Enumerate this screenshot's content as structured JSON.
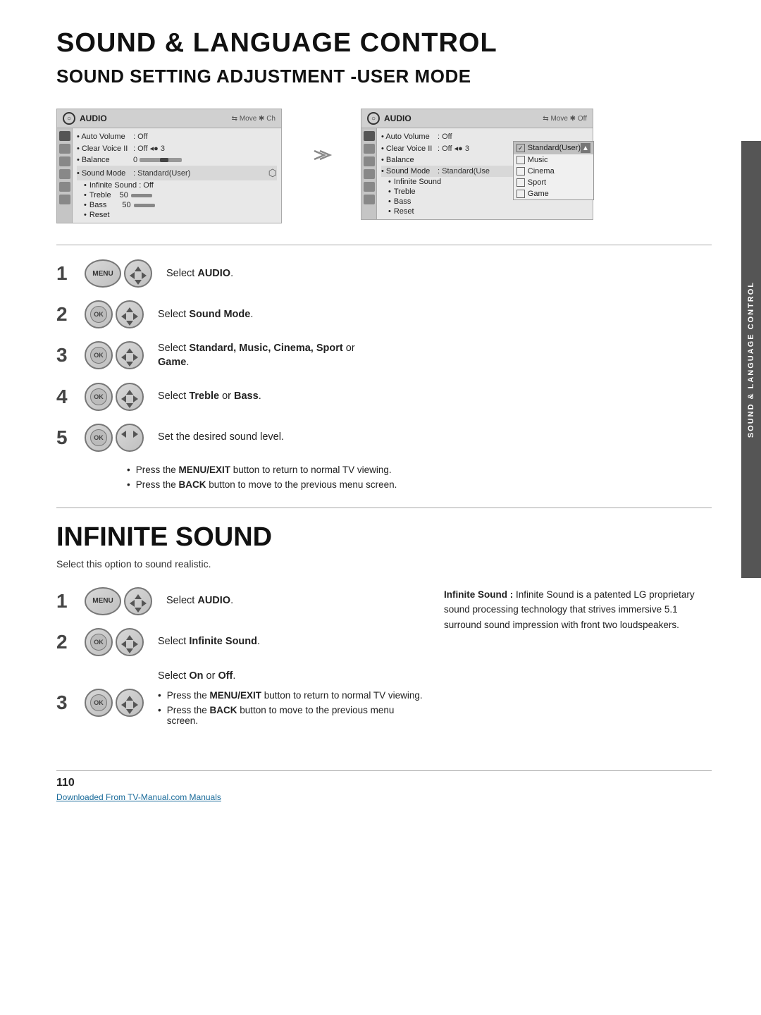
{
  "page": {
    "main_title": "SOUND & LANGUAGE CONTROL",
    "sub_title": "SOUND SETTING ADJUSTMENT -USER MODE",
    "side_label": "SOUND & LANGUAGE CONTROL",
    "page_number": "110",
    "footer_link": "Downloaded From TV-Manual.com Manuals"
  },
  "audio_panel_left": {
    "title": "AUDIO",
    "nav": "Move  Ok Ch",
    "rows": [
      {
        "label": "Auto Volume",
        "value": ": Off"
      },
      {
        "label": "Clear Voice II",
        "value": ": Off  3"
      },
      {
        "label": "Balance",
        "value": "0"
      },
      {
        "label": "Sound Mode",
        "value": ": Standard(User)"
      }
    ],
    "sub_rows": [
      {
        "label": "Infinite Sound",
        "value": ": Off"
      },
      {
        "label": "Treble",
        "value": "50"
      },
      {
        "label": "Bass",
        "value": "50"
      },
      {
        "label": "Reset",
        "value": ""
      }
    ]
  },
  "audio_panel_right": {
    "title": "AUDIO",
    "nav": "Move  Ok Off",
    "rows": [
      {
        "label": "Auto Volume",
        "value": ": Off"
      },
      {
        "label": "Clear Voice II",
        "value": ": Off  3"
      },
      {
        "label": "Balance",
        "value": ""
      },
      {
        "label": "Sound Mode",
        "value": ": Standard(Use"
      }
    ],
    "sub_rows": [
      {
        "label": "Infinite Sound",
        "value": ""
      },
      {
        "label": "Treble",
        "value": ""
      },
      {
        "label": "Bass",
        "value": ""
      },
      {
        "label": "Reset",
        "value": ""
      }
    ],
    "dropdown": {
      "items": [
        {
          "label": "Standard(User)",
          "checked": true
        },
        {
          "label": "Music",
          "checked": false
        },
        {
          "label": "Cinema",
          "checked": false
        },
        {
          "label": "Sport",
          "checked": false
        },
        {
          "label": "Game",
          "checked": false
        }
      ]
    }
  },
  "steps_section1": {
    "steps": [
      {
        "num": "1",
        "text": "Select ",
        "bold": "AUDIO",
        "after": "."
      },
      {
        "num": "2",
        "text": "Select ",
        "bold": "Sound Mode",
        "after": "."
      },
      {
        "num": "3",
        "text": "Select ",
        "bold": "Standard, Music, Cinema, Sport",
        "after": " or\nGame."
      },
      {
        "num": "4",
        "text": "Select ",
        "bold": "Treble",
        "after": " or ",
        "bold2": "Bass",
        "after2": "."
      },
      {
        "num": "5",
        "text": "Set the desired sound level.",
        "bold": ""
      }
    ],
    "notes": [
      {
        "text": "Press the ",
        "bold": "MENU/EXIT",
        "after": " button to return to normal TV viewing."
      },
      {
        "text": "Press the ",
        "bold": "BACK",
        "after": " button to move to the previous menu screen."
      }
    ]
  },
  "infinite_sound": {
    "title": "INFINITE SOUND",
    "desc": "Select this option to sound realistic.",
    "steps": [
      {
        "num": "1",
        "text": "Select ",
        "bold": "AUDIO",
        "after": "."
      },
      {
        "num": "2",
        "text": "Select ",
        "bold": "Infinite Sound",
        "after": "."
      },
      {
        "num": "3",
        "text": "Select ",
        "bold": "On",
        "after": " or ",
        "bold2": "Off",
        "after2": "."
      }
    ],
    "notes": [
      {
        "text": "Press the ",
        "bold": "MENU/EXIT",
        "after": " button to return to normal TV viewing."
      },
      {
        "text": "Press the ",
        "bold": "BACK",
        "after": " button to move to the previous menu screen."
      }
    ],
    "info_box": {
      "title": "Infinite Sound :",
      "text": "Infinite Sound is a patented LG proprietary sound processing technology that strives immersive 5.1 surround sound impression with front two loudspeakers."
    }
  }
}
